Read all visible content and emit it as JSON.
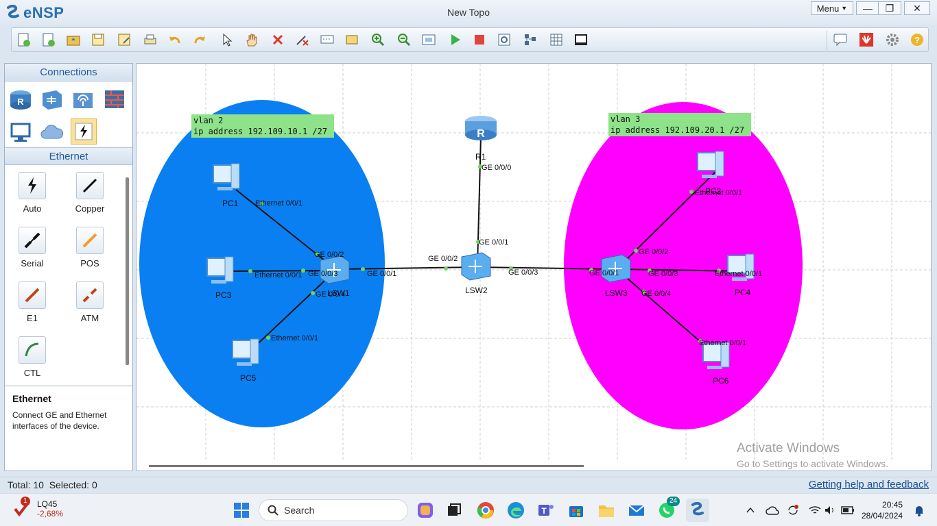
{
  "app": {
    "name": "eNSP",
    "window_title": "New Topo",
    "menu_label": "Menu",
    "window_controls": [
      "minimize-icon",
      "restore-icon",
      "close-icon"
    ]
  },
  "toolbar": {
    "icons": [
      "new-topo-icon",
      "new-example-icon",
      "open-icon",
      "save-icon",
      "save-as-icon",
      "print-icon",
      "undo-icon",
      "redo-icon",
      "select-icon",
      "pan-hand-icon",
      "delete-icon",
      "delete-link-icon",
      "text-note-icon",
      "rectangle-note-icon",
      "zoom-in-icon",
      "zoom-out-icon",
      "fit-icon",
      "start-icon",
      "stop-icon",
      "capture-icon",
      "topology-icon",
      "grid-icon",
      "terminal-icon"
    ],
    "right_icons": [
      "chat-icon",
      "huawei-icon",
      "settings-icon",
      "help-icon"
    ]
  },
  "left_panel": {
    "connections_header": "Connections",
    "device_categories": [
      "router-icon",
      "switch-icon",
      "wireless-icon",
      "firewall-icon",
      "pc-icon",
      "cloud-icon",
      "link-icon"
    ],
    "ethernet_header": "Ethernet",
    "link_types": [
      {
        "label": "Auto",
        "color": "#111111"
      },
      {
        "label": "Copper",
        "color": "#111111"
      },
      {
        "label": "Serial",
        "color": "#111111"
      },
      {
        "label": "POS",
        "color": "#f59b2e"
      },
      {
        "label": "E1",
        "color": "#c0441a"
      },
      {
        "label": "ATM",
        "color": "#c0441a"
      },
      {
        "label": "CTL",
        "color": "#2f8a45"
      }
    ],
    "description_title": "Ethernet",
    "description_text": "Connect GE and Ethernet interfaces of the device."
  },
  "topology": {
    "colors": {
      "vlan2_zone": "#0a7ff2",
      "vlan3_zone": "#ff00ff",
      "note_bg": "#8ee28a",
      "port_dot": "#6fd65a"
    },
    "notes": [
      {
        "text": "vlan 2\nip address 192.109.10.1 /27"
      },
      {
        "text": "vlan 3\nip address 192.109.20.1 /27"
      }
    ],
    "devices": [
      {
        "name": "R1",
        "type": "router"
      },
      {
        "name": "LSW1",
        "type": "switch"
      },
      {
        "name": "LSW2",
        "type": "switch"
      },
      {
        "name": "LSW3",
        "type": "switch"
      },
      {
        "name": "PC1",
        "type": "pc"
      },
      {
        "name": "PC2",
        "type": "pc"
      },
      {
        "name": "PC3",
        "type": "pc"
      },
      {
        "name": "PC4",
        "type": "pc"
      },
      {
        "name": "PC5",
        "type": "pc"
      },
      {
        "name": "PC6",
        "type": "pc"
      }
    ],
    "port_labels": [
      "GE 0/0/0",
      "GE 0/0/1",
      "GE 0/0/2",
      "GE 0/0/1",
      "GE 0/0/3",
      "GE 0/0/2",
      "GE 0/0/3",
      "GE 0/0/4",
      "Ethernet 0/0/1",
      "Ethernet 0/0/1",
      "Ethernet 0/0/1",
      "GE 0/0/1",
      "GE 0/0/2",
      "GE 0/0/3",
      "GE 0/0/4",
      "Ethernet 0/0/1",
      "Ethernet 0/0/1",
      "Ethernet 0/0/1"
    ],
    "watermark_line1": "Activate Windows",
    "watermark_line2": "Go to Settings to activate Windows."
  },
  "status": {
    "left": "Total: 10  Selected: 0",
    "help_link": "Getting help and feedback"
  },
  "taskbar": {
    "stock_name": "LQ45",
    "stock_change": "-2,68%",
    "stock_badge": "1",
    "search_placeholder": "Search",
    "apps": [
      "start-icon",
      "copilot-icon",
      "task-view-icon",
      "chrome-icon",
      "edge-icon",
      "teams-icon",
      "store-icon",
      "file-explorer-icon",
      "mail-icon",
      "whatsapp-icon",
      "ensp-icon"
    ],
    "whatsapp_badge": "24",
    "time": "20:45",
    "date": "28/04/2024"
  }
}
